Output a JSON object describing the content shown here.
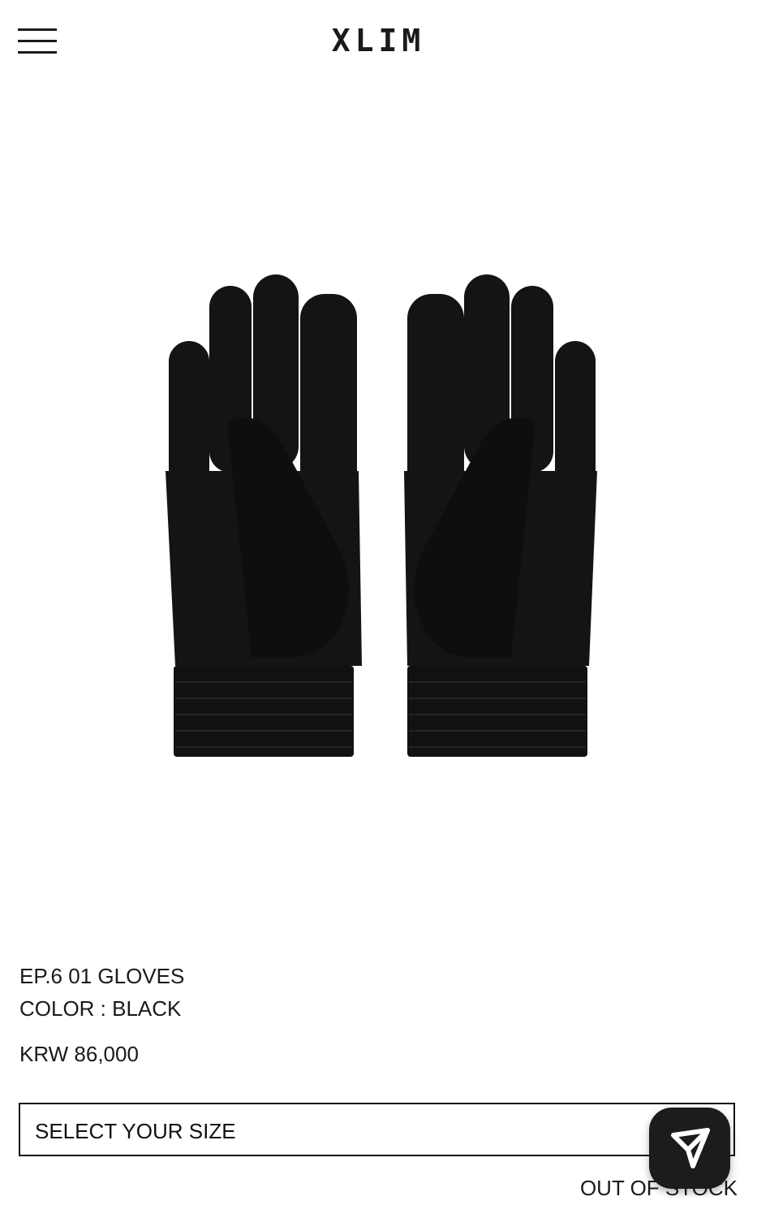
{
  "header": {
    "logo": "XLIM"
  },
  "product": {
    "name": "EP.6 01 GLOVES",
    "color": "COLOR : BLACK",
    "price": "KRW 86,000",
    "size_select_label": "SELECT YOUR SIZE",
    "stock_status": "OUT OF STOCK"
  },
  "icons": {
    "menu": "hamburger-icon",
    "share": "paper-plane-icon"
  },
  "colors": {
    "background": "#ffffff",
    "text": "#1a1a1a",
    "glove": "#141414",
    "share_button": "#1c1c1c"
  }
}
